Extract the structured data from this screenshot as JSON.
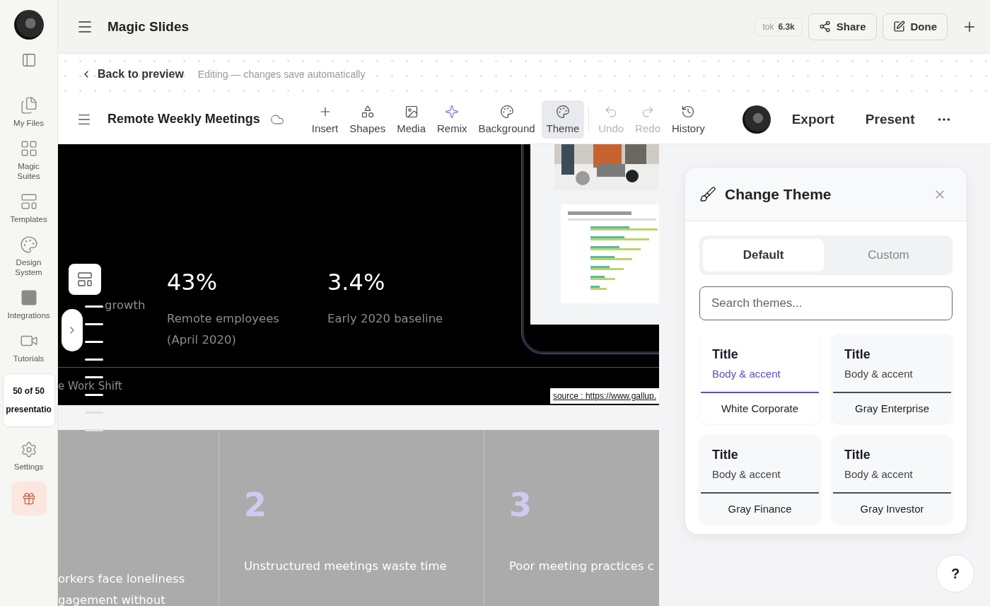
{
  "sidebar": {
    "items": [
      {
        "label": "My Files"
      },
      {
        "label": "Magic Suites"
      },
      {
        "label": "Templates"
      },
      {
        "label": "Design System"
      },
      {
        "label": "Integrations"
      },
      {
        "label": "Tutorials"
      }
    ],
    "usage": {
      "count": "50 of 50",
      "label": "presentatio"
    },
    "settings": "Settings"
  },
  "app_bar": {
    "title": "Magic Slides",
    "tokens": {
      "label": "tok",
      "value": "6.3k"
    },
    "share": "Share",
    "done": "Done"
  },
  "editing_bar": {
    "back": "Back to preview",
    "status": "Editing — changes save automatically"
  },
  "toolbar": {
    "document_title": "Remote Weekly Meetings",
    "tools": [
      {
        "label": "Insert",
        "selected": false,
        "disabled": false
      },
      {
        "label": "Shapes",
        "selected": false,
        "disabled": false
      },
      {
        "label": "Media",
        "selected": false,
        "disabled": false
      },
      {
        "label": "Remix",
        "selected": false,
        "disabled": false
      },
      {
        "label": "Background",
        "selected": false,
        "disabled": false
      },
      {
        "label": "Theme",
        "selected": true,
        "disabled": false
      },
      {
        "label": "Undo",
        "selected": false,
        "disabled": true
      },
      {
        "label": "Redo",
        "selected": false,
        "disabled": true
      },
      {
        "label": "History",
        "selected": false,
        "disabled": false
      }
    ],
    "export": "Export",
    "present": "Present"
  },
  "slide_1": {
    "stats": [
      {
        "label": "growth"
      },
      {
        "value": "43%",
        "label": "Remote employees (April 2020)"
      },
      {
        "value": "3.4%",
        "label": "Early 2020 baseline"
      }
    ],
    "footer": "e Work Shift",
    "source": "source : https://www.gallup."
  },
  "slide_2": {
    "columns": [
      {
        "lines": [
          "orkers face loneliness",
          "gagement without"
        ]
      },
      {
        "number": "2",
        "lines": [
          "Unstructured meetings waste time"
        ]
      },
      {
        "number": "3",
        "lines": [
          "Poor meeting practices c"
        ]
      }
    ]
  },
  "theme_panel": {
    "title": "Change Theme",
    "tabs": [
      {
        "label": "Default",
        "selected": true
      },
      {
        "label": "Custom",
        "selected": false
      }
    ],
    "search": {
      "placeholder": "Search themes..."
    },
    "themes": [
      {
        "title": "Title",
        "sample": "Body & accent",
        "name": "White Corporate",
        "selected": true,
        "color": "#5b4fc4"
      },
      {
        "title": "Title",
        "sample": "Body & accent",
        "name": "Gray Enterprise",
        "selected": false,
        "color": "#4a4d55"
      },
      {
        "title": "Title",
        "sample": "Body & accent",
        "name": "Gray Finance",
        "selected": false,
        "color": "#4a4d55"
      },
      {
        "title": "Title",
        "sample": "Body & accent",
        "name": "Gray Investor",
        "selected": false,
        "color": "#4a4d55"
      }
    ]
  },
  "help": "?"
}
